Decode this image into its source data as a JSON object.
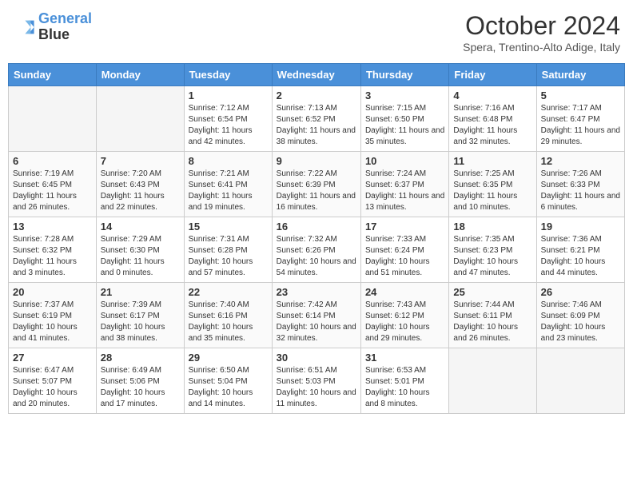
{
  "header": {
    "logo_line1": "General",
    "logo_line2": "Blue",
    "month": "October 2024",
    "location": "Spera, Trentino-Alto Adige, Italy"
  },
  "days_of_week": [
    "Sunday",
    "Monday",
    "Tuesday",
    "Wednesday",
    "Thursday",
    "Friday",
    "Saturday"
  ],
  "weeks": [
    [
      {
        "day": "",
        "empty": true
      },
      {
        "day": "",
        "empty": true
      },
      {
        "day": "1",
        "sunrise": "Sunrise: 7:12 AM",
        "sunset": "Sunset: 6:54 PM",
        "daylight": "Daylight: 11 hours and 42 minutes."
      },
      {
        "day": "2",
        "sunrise": "Sunrise: 7:13 AM",
        "sunset": "Sunset: 6:52 PM",
        "daylight": "Daylight: 11 hours and 38 minutes."
      },
      {
        "day": "3",
        "sunrise": "Sunrise: 7:15 AM",
        "sunset": "Sunset: 6:50 PM",
        "daylight": "Daylight: 11 hours and 35 minutes."
      },
      {
        "day": "4",
        "sunrise": "Sunrise: 7:16 AM",
        "sunset": "Sunset: 6:48 PM",
        "daylight": "Daylight: 11 hours and 32 minutes."
      },
      {
        "day": "5",
        "sunrise": "Sunrise: 7:17 AM",
        "sunset": "Sunset: 6:47 PM",
        "daylight": "Daylight: 11 hours and 29 minutes."
      }
    ],
    [
      {
        "day": "6",
        "sunrise": "Sunrise: 7:19 AM",
        "sunset": "Sunset: 6:45 PM",
        "daylight": "Daylight: 11 hours and 26 minutes."
      },
      {
        "day": "7",
        "sunrise": "Sunrise: 7:20 AM",
        "sunset": "Sunset: 6:43 PM",
        "daylight": "Daylight: 11 hours and 22 minutes."
      },
      {
        "day": "8",
        "sunrise": "Sunrise: 7:21 AM",
        "sunset": "Sunset: 6:41 PM",
        "daylight": "Daylight: 11 hours and 19 minutes."
      },
      {
        "day": "9",
        "sunrise": "Sunrise: 7:22 AM",
        "sunset": "Sunset: 6:39 PM",
        "daylight": "Daylight: 11 hours and 16 minutes."
      },
      {
        "day": "10",
        "sunrise": "Sunrise: 7:24 AM",
        "sunset": "Sunset: 6:37 PM",
        "daylight": "Daylight: 11 hours and 13 minutes."
      },
      {
        "day": "11",
        "sunrise": "Sunrise: 7:25 AM",
        "sunset": "Sunset: 6:35 PM",
        "daylight": "Daylight: 11 hours and 10 minutes."
      },
      {
        "day": "12",
        "sunrise": "Sunrise: 7:26 AM",
        "sunset": "Sunset: 6:33 PM",
        "daylight": "Daylight: 11 hours and 6 minutes."
      }
    ],
    [
      {
        "day": "13",
        "sunrise": "Sunrise: 7:28 AM",
        "sunset": "Sunset: 6:32 PM",
        "daylight": "Daylight: 11 hours and 3 minutes."
      },
      {
        "day": "14",
        "sunrise": "Sunrise: 7:29 AM",
        "sunset": "Sunset: 6:30 PM",
        "daylight": "Daylight: 11 hours and 0 minutes."
      },
      {
        "day": "15",
        "sunrise": "Sunrise: 7:31 AM",
        "sunset": "Sunset: 6:28 PM",
        "daylight": "Daylight: 10 hours and 57 minutes."
      },
      {
        "day": "16",
        "sunrise": "Sunrise: 7:32 AM",
        "sunset": "Sunset: 6:26 PM",
        "daylight": "Daylight: 10 hours and 54 minutes."
      },
      {
        "day": "17",
        "sunrise": "Sunrise: 7:33 AM",
        "sunset": "Sunset: 6:24 PM",
        "daylight": "Daylight: 10 hours and 51 minutes."
      },
      {
        "day": "18",
        "sunrise": "Sunrise: 7:35 AM",
        "sunset": "Sunset: 6:23 PM",
        "daylight": "Daylight: 10 hours and 47 minutes."
      },
      {
        "day": "19",
        "sunrise": "Sunrise: 7:36 AM",
        "sunset": "Sunset: 6:21 PM",
        "daylight": "Daylight: 10 hours and 44 minutes."
      }
    ],
    [
      {
        "day": "20",
        "sunrise": "Sunrise: 7:37 AM",
        "sunset": "Sunset: 6:19 PM",
        "daylight": "Daylight: 10 hours and 41 minutes."
      },
      {
        "day": "21",
        "sunrise": "Sunrise: 7:39 AM",
        "sunset": "Sunset: 6:17 PM",
        "daylight": "Daylight: 10 hours and 38 minutes."
      },
      {
        "day": "22",
        "sunrise": "Sunrise: 7:40 AM",
        "sunset": "Sunset: 6:16 PM",
        "daylight": "Daylight: 10 hours and 35 minutes."
      },
      {
        "day": "23",
        "sunrise": "Sunrise: 7:42 AM",
        "sunset": "Sunset: 6:14 PM",
        "daylight": "Daylight: 10 hours and 32 minutes."
      },
      {
        "day": "24",
        "sunrise": "Sunrise: 7:43 AM",
        "sunset": "Sunset: 6:12 PM",
        "daylight": "Daylight: 10 hours and 29 minutes."
      },
      {
        "day": "25",
        "sunrise": "Sunrise: 7:44 AM",
        "sunset": "Sunset: 6:11 PM",
        "daylight": "Daylight: 10 hours and 26 minutes."
      },
      {
        "day": "26",
        "sunrise": "Sunrise: 7:46 AM",
        "sunset": "Sunset: 6:09 PM",
        "daylight": "Daylight: 10 hours and 23 minutes."
      }
    ],
    [
      {
        "day": "27",
        "sunrise": "Sunrise: 6:47 AM",
        "sunset": "Sunset: 5:07 PM",
        "daylight": "Daylight: 10 hours and 20 minutes."
      },
      {
        "day": "28",
        "sunrise": "Sunrise: 6:49 AM",
        "sunset": "Sunset: 5:06 PM",
        "daylight": "Daylight: 10 hours and 17 minutes."
      },
      {
        "day": "29",
        "sunrise": "Sunrise: 6:50 AM",
        "sunset": "Sunset: 5:04 PM",
        "daylight": "Daylight: 10 hours and 14 minutes."
      },
      {
        "day": "30",
        "sunrise": "Sunrise: 6:51 AM",
        "sunset": "Sunset: 5:03 PM",
        "daylight": "Daylight: 10 hours and 11 minutes."
      },
      {
        "day": "31",
        "sunrise": "Sunrise: 6:53 AM",
        "sunset": "Sunset: 5:01 PM",
        "daylight": "Daylight: 10 hours and 8 minutes."
      },
      {
        "day": "",
        "empty": true
      },
      {
        "day": "",
        "empty": true
      }
    ]
  ]
}
